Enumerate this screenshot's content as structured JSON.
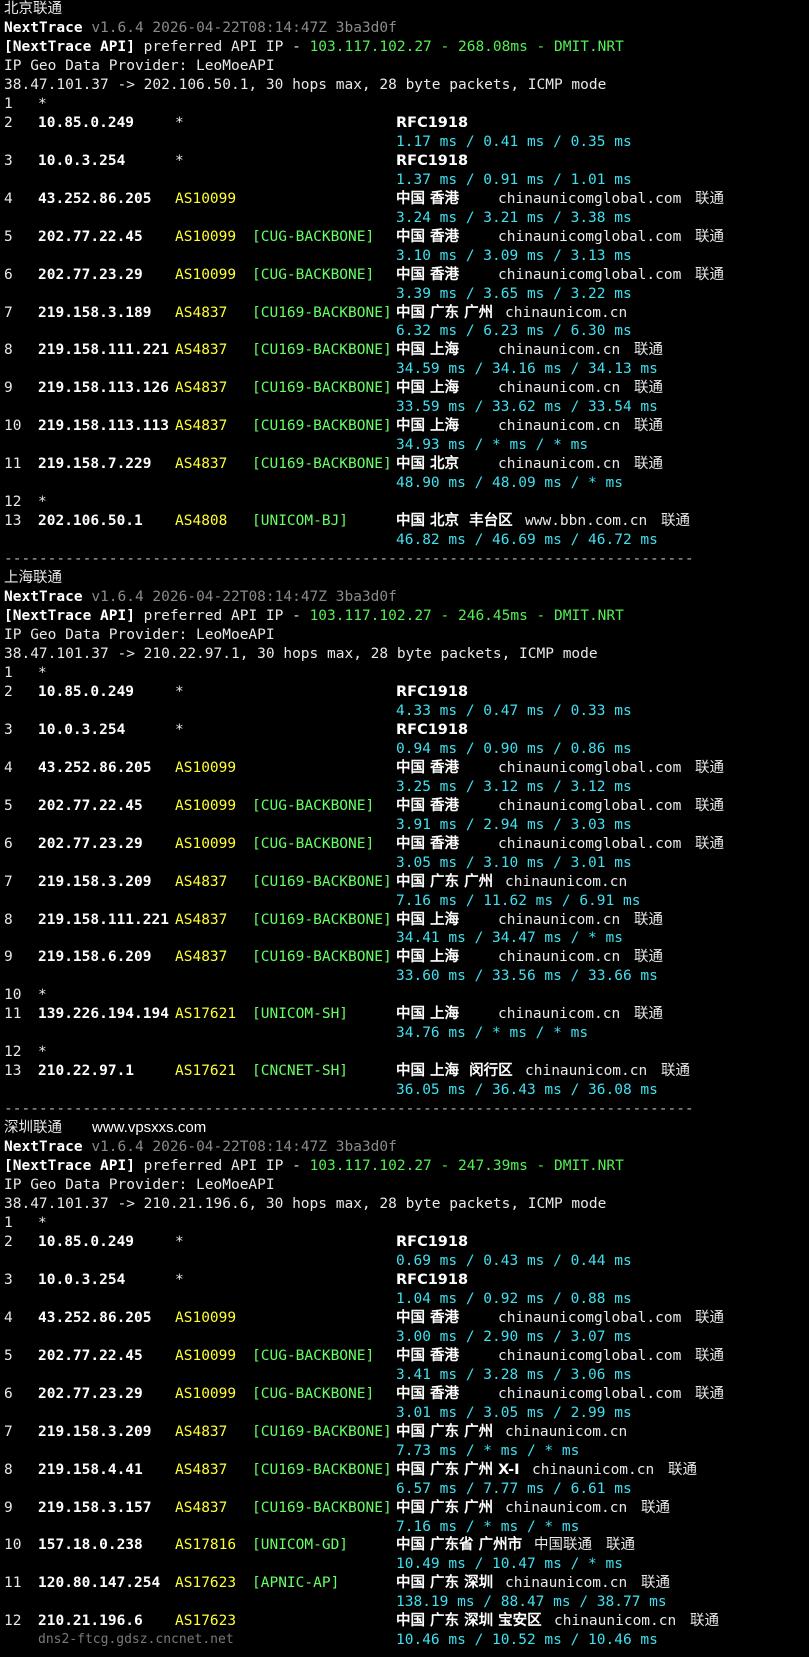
{
  "watermark": "www.vpsxxs.com",
  "sections": [
    {
      "name": "北京联通",
      "header": {
        "tool": "NextTrace",
        "version": "v1.6.4 2026-04-22T08:14:47Z 3ba3d0f",
        "api_prefix": "[NextTrace API]",
        "api_text": " preferred API IP - ",
        "api_ip": "103.117.102.27",
        "api_sep": " - ",
        "api_latency": "268.08ms",
        "api_node": "DMIT.NRT",
        "provider": "IP Geo Data Provider: LeoMoeAPI",
        "route": "38.47.101.37 -> 202.106.50.1, 30 hops max, 28 byte packets, ICMP mode"
      },
      "hops": [
        {
          "n": "1",
          "ip": "*"
        },
        {
          "n": "2",
          "ip": "10.85.0.249",
          "as": "*",
          "geo": "RFC1918",
          "rtt": "1.17 ms / 0.41 ms / 0.35 ms"
        },
        {
          "n": "3",
          "ip": "10.0.3.254",
          "as": "*",
          "geo": "RFC1918",
          "rtt": "1.37 ms / 0.91 ms / 1.01 ms"
        },
        {
          "n": "4",
          "ip": "43.252.86.205",
          "as": "AS10099",
          "geo": "中国 香港",
          "domain": "chinaunicomglobal.com",
          "isp": "联通",
          "rtt": "3.24 ms / 3.21 ms / 3.38 ms"
        },
        {
          "n": "5",
          "ip": "202.77.22.45",
          "as": "AS10099",
          "tag": "[CUG-BACKBONE]",
          "geo": "中国 香港",
          "domain": "chinaunicomglobal.com",
          "isp": "联通",
          "rtt": "3.10 ms / 3.09 ms / 3.13 ms"
        },
        {
          "n": "6",
          "ip": "202.77.23.29",
          "as": "AS10099",
          "tag": "[CUG-BACKBONE]",
          "geo": "中国 香港",
          "domain": "chinaunicomglobal.com",
          "isp": "联通",
          "rtt": "3.39 ms / 3.65 ms / 3.22 ms"
        },
        {
          "n": "7",
          "ip": "219.158.3.189",
          "as": "AS4837",
          "tag": "[CU169-BACKBONE]",
          "geo": "中国 广东 广州",
          "domain": "chinaunicom.cn",
          "rtt": "6.32 ms / 6.23 ms / 6.30 ms"
        },
        {
          "n": "8",
          "ip": "219.158.111.221",
          "as": "AS4837",
          "tag": "[CU169-BACKBONE]",
          "geo": "中国 上海",
          "domain": "chinaunicom.cn",
          "isp": "联通",
          "rtt": "34.59 ms / 34.16 ms / 34.13 ms"
        },
        {
          "n": "9",
          "ip": "219.158.113.126",
          "as": "AS4837",
          "tag": "[CU169-BACKBONE]",
          "geo": "中国 上海",
          "domain": "chinaunicom.cn",
          "isp": "联通",
          "rtt": "33.59 ms / 33.62 ms / 33.54 ms"
        },
        {
          "n": "10",
          "ip": "219.158.113.113",
          "as": "AS4837",
          "tag": "[CU169-BACKBONE]",
          "geo": "中国 上海",
          "domain": "chinaunicom.cn",
          "isp": "联通",
          "rtt": "34.93 ms / * ms / * ms"
        },
        {
          "n": "11",
          "ip": "219.158.7.229",
          "as": "AS4837",
          "tag": "[CU169-BACKBONE]",
          "geo": "中国 北京",
          "domain": "chinaunicom.cn",
          "isp": "联通",
          "rtt": "48.90 ms / 48.09 ms / * ms"
        },
        {
          "n": "12",
          "ip": "*"
        },
        {
          "n": "13",
          "ip": "202.106.50.1",
          "as": "AS4808",
          "tag": "[UNICOM-BJ]",
          "geo": "中国 北京  丰台区",
          "domain": "www.bbn.com.cn",
          "isp": "联通",
          "rtt": "46.82 ms / 46.69 ms / 46.72 ms"
        }
      ]
    },
    {
      "name": "上海联通",
      "header": {
        "tool": "NextTrace",
        "version": "v1.6.4 2026-04-22T08:14:47Z 3ba3d0f",
        "api_prefix": "[NextTrace API]",
        "api_text": " preferred API IP - ",
        "api_ip": "103.117.102.27",
        "api_sep": " - ",
        "api_latency": "246.45ms",
        "api_node": "DMIT.NRT",
        "provider": "IP Geo Data Provider: LeoMoeAPI",
        "route": "38.47.101.37 -> 210.22.97.1, 30 hops max, 28 byte packets, ICMP mode"
      },
      "hops": [
        {
          "n": "1",
          "ip": "*"
        },
        {
          "n": "2",
          "ip": "10.85.0.249",
          "as": "*",
          "geo": "RFC1918",
          "rtt": "4.33 ms / 0.47 ms / 0.33 ms"
        },
        {
          "n": "3",
          "ip": "10.0.3.254",
          "as": "*",
          "geo": "RFC1918",
          "rtt": "0.94 ms / 0.90 ms / 0.86 ms"
        },
        {
          "n": "4",
          "ip": "43.252.86.205",
          "as": "AS10099",
          "geo": "中国 香港",
          "domain": "chinaunicomglobal.com",
          "isp": "联通",
          "rtt": "3.25 ms / 3.12 ms / 3.12 ms"
        },
        {
          "n": "5",
          "ip": "202.77.22.45",
          "as": "AS10099",
          "tag": "[CUG-BACKBONE]",
          "geo": "中国 香港",
          "domain": "chinaunicomglobal.com",
          "isp": "联通",
          "rtt": "3.91 ms / 2.94 ms / 3.03 ms"
        },
        {
          "n": "6",
          "ip": "202.77.23.29",
          "as": "AS10099",
          "tag": "[CUG-BACKBONE]",
          "geo": "中国 香港",
          "domain": "chinaunicomglobal.com",
          "isp": "联通",
          "rtt": "3.05 ms / 3.10 ms / 3.01 ms"
        },
        {
          "n": "7",
          "ip": "219.158.3.209",
          "as": "AS4837",
          "tag": "[CU169-BACKBONE]",
          "geo": "中国 广东 广州",
          "domain": "chinaunicom.cn",
          "rtt": "7.16 ms / 11.62 ms / 6.91 ms"
        },
        {
          "n": "8",
          "ip": "219.158.111.221",
          "as": "AS4837",
          "tag": "[CU169-BACKBONE]",
          "geo": "中国 上海",
          "domain": "chinaunicom.cn",
          "isp": "联通",
          "rtt": "34.41 ms / 34.47 ms / * ms"
        },
        {
          "n": "9",
          "ip": "219.158.6.209",
          "as": "AS4837",
          "tag": "[CU169-BACKBONE]",
          "geo": "中国 上海",
          "domain": "chinaunicom.cn",
          "isp": "联通",
          "rtt": "33.60 ms / 33.56 ms / 33.66 ms"
        },
        {
          "n": "10",
          "ip": "*"
        },
        {
          "n": "11",
          "ip": "139.226.194.194",
          "as": "AS17621",
          "tag": "[UNICOM-SH]",
          "geo": "中国 上海",
          "domain": "chinaunicom.cn",
          "isp": "联通",
          "rtt": "34.76 ms / * ms / * ms"
        },
        {
          "n": "12",
          "ip": "*"
        },
        {
          "n": "13",
          "ip": "210.22.97.1",
          "as": "AS17621",
          "tag": "[CNCNET-SH]",
          "geo": "中国 上海  闵行区",
          "domain": "chinaunicom.cn",
          "isp": "联通",
          "rtt": "36.05 ms / 36.43 ms / 36.08 ms"
        }
      ]
    },
    {
      "name": "深圳联通",
      "header": {
        "tool": "NextTrace",
        "version": "v1.6.4 2026-04-22T08:14:47Z 3ba3d0f",
        "api_prefix": "[NextTrace API]",
        "api_text": " preferred API IP - ",
        "api_ip": "103.117.102.27",
        "api_sep": " - ",
        "api_latency": "247.39ms",
        "api_node": "DMIT.NRT",
        "provider": "IP Geo Data Provider: LeoMoeAPI",
        "route": "38.47.101.37 -> 210.21.196.6, 30 hops max, 28 byte packets, ICMP mode"
      },
      "hops": [
        {
          "n": "1",
          "ip": "*"
        },
        {
          "n": "2",
          "ip": "10.85.0.249",
          "as": "*",
          "geo": "RFC1918",
          "rtt": "0.69 ms / 0.43 ms / 0.44 ms"
        },
        {
          "n": "3",
          "ip": "10.0.3.254",
          "as": "*",
          "geo": "RFC1918",
          "rtt": "1.04 ms / 0.92 ms / 0.88 ms"
        },
        {
          "n": "4",
          "ip": "43.252.86.205",
          "as": "AS10099",
          "geo": "中国 香港",
          "domain": "chinaunicomglobal.com",
          "isp": "联通",
          "rtt": "3.00 ms / 2.90 ms / 3.07 ms"
        },
        {
          "n": "5",
          "ip": "202.77.22.45",
          "as": "AS10099",
          "tag": "[CUG-BACKBONE]",
          "geo": "中国 香港",
          "domain": "chinaunicomglobal.com",
          "isp": "联通",
          "rtt": "3.41 ms / 3.28 ms / 3.06 ms"
        },
        {
          "n": "6",
          "ip": "202.77.23.29",
          "as": "AS10099",
          "tag": "[CUG-BACKBONE]",
          "geo": "中国 香港",
          "domain": "chinaunicomglobal.com",
          "isp": "联通",
          "rtt": "3.01 ms / 3.05 ms / 2.99 ms"
        },
        {
          "n": "7",
          "ip": "219.158.3.209",
          "as": "AS4837",
          "tag": "[CU169-BACKBONE]",
          "geo": "中国 广东 广州",
          "domain": "chinaunicom.cn",
          "rtt": "7.73 ms / * ms / * ms"
        },
        {
          "n": "8",
          "ip": "219.158.4.41",
          "as": "AS4837",
          "tag": "[CU169-BACKBONE]",
          "geo": "中国 广东 广州 X-I",
          "domain": "chinaunicom.cn",
          "isp": "联通",
          "rtt": "6.57 ms / 7.77 ms / 6.61 ms"
        },
        {
          "n": "9",
          "ip": "219.158.3.157",
          "as": "AS4837",
          "tag": "[CU169-BACKBONE]",
          "geo": "中国 广东 广州",
          "domain": "chinaunicom.cn",
          "isp": "联通",
          "rtt": "7.16 ms / * ms / * ms"
        },
        {
          "n": "10",
          "ip": "157.18.0.238",
          "as": "AS17816",
          "tag": "[UNICOM-GD]",
          "geo": "中国 广东省 广州市",
          "domain": "中国联通",
          "isp": "联通",
          "rtt": "10.49 ms / 10.47 ms / * ms"
        },
        {
          "n": "11",
          "ip": "120.80.147.254",
          "as": "AS17623",
          "tag": "[APNIC-AP]",
          "geo": "中国 广东 深圳",
          "domain": "chinaunicom.cn",
          "isp": "联通",
          "rtt": "138.19 ms / 88.47 ms / 38.77 ms"
        },
        {
          "n": "12",
          "ip": "210.21.196.6",
          "as": "AS17623",
          "geo": "中国 广东 深圳 宝安区",
          "domain": "chinaunicom.cn",
          "isp": "联通",
          "rtt": "10.46 ms / 10.52 ms / 10.46 ms",
          "hostname": "dns2-ftcg.gdsz.cncnet.net"
        }
      ]
    }
  ],
  "separator": "-------------------------------------------------------------------------------"
}
